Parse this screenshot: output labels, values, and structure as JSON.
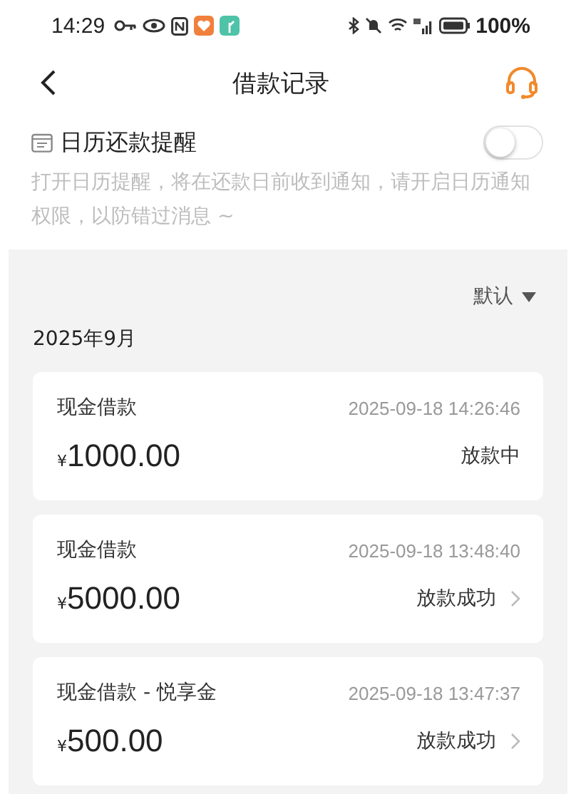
{
  "status_bar": {
    "time": "14:29",
    "battery": "100%"
  },
  "nav": {
    "title": "借款记录"
  },
  "reminder": {
    "title": "日历还款提醒",
    "on": false,
    "description": "打开日历提醒，将在还款日前收到通知，请开启日历通知权限，以防错过消息 ~"
  },
  "sort": {
    "label": "默认"
  },
  "month": "2025年9月",
  "records": [
    {
      "name": "现金借款",
      "time": "2025-09-18 14:26:46",
      "currency": "¥",
      "amount": "1000.00",
      "status": "放款中",
      "chevron": false
    },
    {
      "name": "现金借款",
      "time": "2025-09-18 13:48:40",
      "currency": "¥",
      "amount": "5000.00",
      "status": "放款成功",
      "chevron": true
    },
    {
      "name": "现金借款 - 悦享金",
      "time": "2025-09-18 13:47:37",
      "currency": "¥",
      "amount": "500.00",
      "status": "放款成功",
      "chevron": true
    }
  ]
}
